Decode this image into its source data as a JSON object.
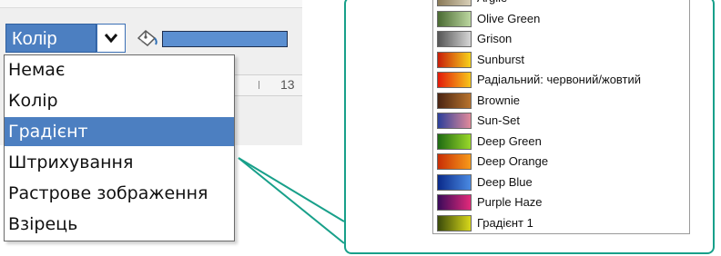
{
  "toolbar": {
    "fill_type_value": "Колір",
    "ruler_number": "13",
    "color_bar_color": "#5b8fd1"
  },
  "fill_menu": {
    "items": [
      {
        "label": "Немає",
        "selected": false
      },
      {
        "label": "Колір",
        "selected": false
      },
      {
        "label": "Градієнт",
        "selected": true
      },
      {
        "label": "Штрихування",
        "selected": false
      },
      {
        "label": "Растрове зображення",
        "selected": false
      },
      {
        "label": "Взірець",
        "selected": false
      }
    ]
  },
  "gradient_list": {
    "items": [
      {
        "label": "Argile",
        "colors": [
          "#8a7a58",
          "#d8cfb8"
        ]
      },
      {
        "label": "Olive Green",
        "colors": [
          "#4a6a32",
          "#bcd7a0"
        ]
      },
      {
        "label": "Grison",
        "colors": [
          "#555555",
          "#d6d6d6"
        ]
      },
      {
        "label": "Sunburst",
        "colors": [
          "#c81e0a",
          "#f7d21a"
        ]
      },
      {
        "label": "Радіальний: червоний/жовтий",
        "colors": [
          "#e21a0a",
          "#f7c71a"
        ]
      },
      {
        "label": "Brownie",
        "colors": [
          "#4a2412",
          "#b8742e"
        ]
      },
      {
        "label": "Sun-Set",
        "colors": [
          "#2c3f9a",
          "#e28a9a"
        ]
      },
      {
        "label": "Deep Green",
        "colors": [
          "#1e6a12",
          "#9ad82a"
        ]
      },
      {
        "label": "Deep Orange",
        "colors": [
          "#c82e06",
          "#f79a1a"
        ]
      },
      {
        "label": "Deep Blue",
        "colors": [
          "#0a2a8a",
          "#4a8ae2"
        ]
      },
      {
        "label": "Purple Haze",
        "colors": [
          "#3a0a5a",
          "#e22a7a"
        ]
      },
      {
        "label": "Градієнт 1",
        "colors": [
          "#3a4a0a",
          "#d8d81a"
        ]
      }
    ]
  },
  "accent_color": "#18a08a",
  "selection_color": "#4c7fc1"
}
